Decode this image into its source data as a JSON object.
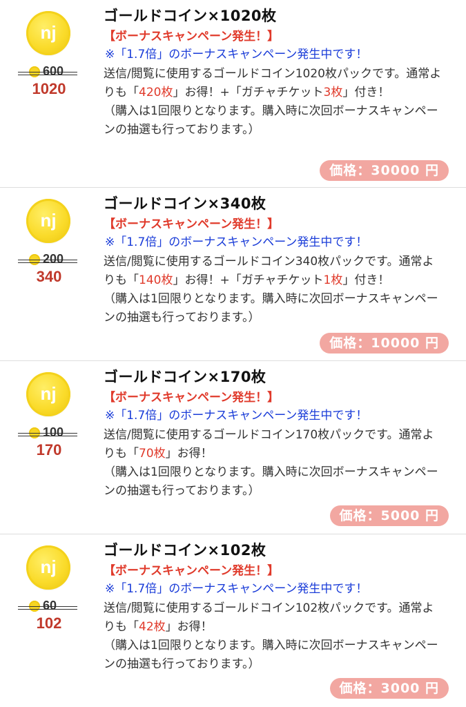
{
  "products": [
    {
      "title": "ゴールドコイン×1020枚",
      "bonus_label": "【ボーナスキャンペーン発生！】",
      "note": "※「1.7倍」のボーナスキャンペーン発生中です！",
      "desc_a": "送信/閲覧に使用するゴールドコイン1020枚パックです。通常よりも「",
      "save_count": "420枚",
      "desc_b": "」お得！+「ガチャチケット",
      "ticket_count": "3枚",
      "desc_c": "」付き！",
      "sub_note": "（購入は1回限りとなります。購入時に次回ボーナスキャンペーンの抽選も行っております。）",
      "old_coins": "600",
      "new_coins": "1020",
      "price": "価格：30000 円"
    },
    {
      "title": "ゴールドコイン×340枚",
      "bonus_label": "【ボーナスキャンペーン発生！】",
      "note": "※「1.7倍」のボーナスキャンペーン発生中です！",
      "desc_a": "送信/閲覧に使用するゴールドコイン340枚パックです。通常よりも「",
      "save_count": "140枚",
      "desc_b": "」お得！+「ガチャチケット",
      "ticket_count": "1枚",
      "desc_c": "」付き！",
      "sub_note": "（購入は1回限りとなります。購入時に次回ボーナスキャンペーンの抽選も行っております。）",
      "old_coins": "200",
      "new_coins": "340",
      "price": "価格：10000 円"
    },
    {
      "title": "ゴールドコイン×170枚",
      "bonus_label": "【ボーナスキャンペーン発生！】",
      "note": "※「1.7倍」のボーナスキャンペーン発生中です！",
      "desc_a": "送信/閲覧に使用するゴールドコイン170枚パックです。通常よりも「",
      "save_count": "70枚",
      "desc_b": "」お得！",
      "sub_note": "（購入は1回限りとなります。購入時に次回ボーナスキャンペーンの抽選も行っております。）",
      "old_coins": "100",
      "new_coins": "170",
      "price": "価格：5000 円"
    },
    {
      "title": "ゴールドコイン×102枚",
      "bonus_label": "【ボーナスキャンペーン発生！】",
      "note": "※「1.7倍」のボーナスキャンペーン発生中です！",
      "desc_a": "送信/閲覧に使用するゴールドコイン102枚パックです。通常よりも「",
      "save_count": "42枚",
      "desc_b": "」お得！",
      "sub_note": "（購入は1回限りとなります。購入時に次回ボーナスキャンペーンの抽選も行っております。）",
      "old_coins": "60",
      "new_coins": "102",
      "price": "価格：3000 円"
    }
  ],
  "icons": {
    "coin": "gold-coin-icon",
    "mini_coin": "mini-coin-icon"
  },
  "colors": {
    "accent_red": "#e03a2b",
    "note_blue": "#1a3cd8",
    "price_bg": "#f2a7a1",
    "coin_gold": "#fadb2a"
  }
}
